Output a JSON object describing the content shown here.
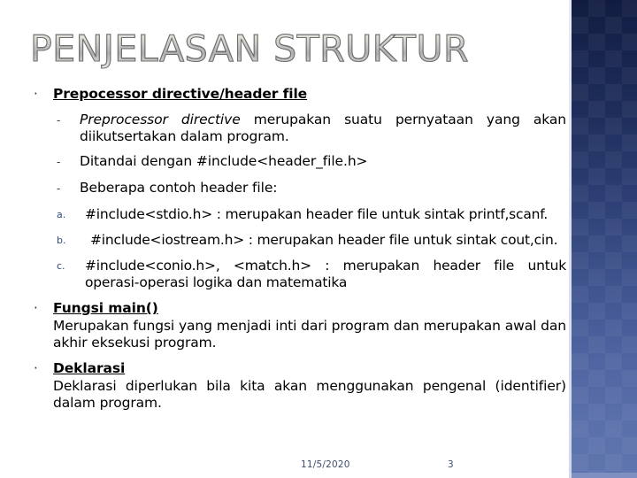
{
  "slide": {
    "title": "PENJELASAN STRUKTUR",
    "accent_dark": "#16224a",
    "accent_light": "#5f75ae",
    "bullet_dot": "·",
    "bullet_dash": "-"
  },
  "sections": [
    {
      "heading": "Prepocessor directive/header file",
      "marker": "·",
      "sub_items": [
        {
          "marker": "-",
          "italic_lead": "Preprocessor directive",
          "text": " merupakan suatu pernyataan yang akan diikutsertakan dalam program."
        },
        {
          "marker": "-",
          "italic_lead": "",
          "text": "Ditandai dengan #include<header_file.h>"
        },
        {
          "marker": "-",
          "italic_lead": "",
          "text": "Beberapa contoh header file:"
        }
      ],
      "lettered_items": [
        {
          "marker": "a.",
          "text": "#include<stdio.h> : merupakan header file untuk sintak printf,scanf."
        },
        {
          "marker": "b.",
          "text": "#include<iostream.h> : merupakan header file untuk sintak cout,cin."
        },
        {
          "marker": "c.",
          "text": "#include<conio.h>, <match.h> : merupakan header file untuk operasi-operasi logika dan matematika"
        }
      ]
    },
    {
      "heading": "Fungsi main()",
      "marker": "·",
      "paragraph": "Merupakan fungsi yang menjadi inti dari program dan merupakan awal dan akhir eksekusi program."
    },
    {
      "heading": "Deklarasi",
      "marker": "·",
      "paragraph": "Deklarasi diperlukan bila kita akan menggunakan pengenal (identifier) dalam program."
    }
  ],
  "footer": {
    "date": "11/5/2020",
    "page": "3"
  }
}
